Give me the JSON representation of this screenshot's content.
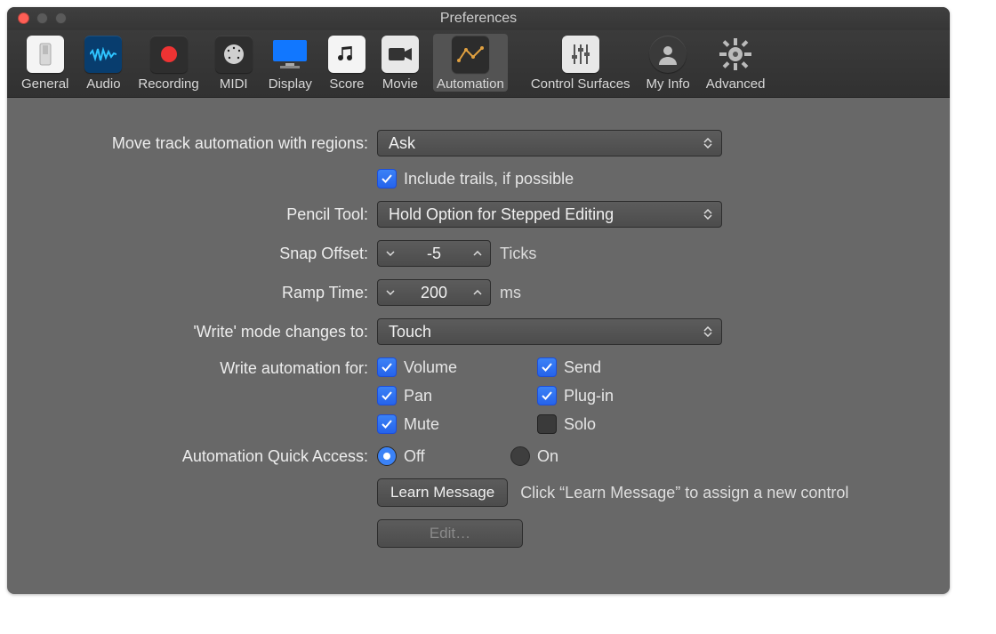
{
  "window": {
    "title": "Preferences"
  },
  "toolbar": {
    "selected": "Automation",
    "items": [
      {
        "id": "general",
        "label": "General"
      },
      {
        "id": "audio",
        "label": "Audio"
      },
      {
        "id": "recording",
        "label": "Recording"
      },
      {
        "id": "midi",
        "label": "MIDI"
      },
      {
        "id": "display",
        "label": "Display"
      },
      {
        "id": "score",
        "label": "Score"
      },
      {
        "id": "movie",
        "label": "Movie"
      },
      {
        "id": "automation",
        "label": "Automation"
      },
      {
        "id": "control-surfaces",
        "label": "Control Surfaces"
      },
      {
        "id": "my-info",
        "label": "My Info"
      },
      {
        "id": "advanced",
        "label": "Advanced"
      }
    ]
  },
  "form": {
    "move_label": "Move track automation with regions:",
    "move_value": "Ask",
    "include_trails": "Include trails, if possible",
    "pencil_label": "Pencil Tool:",
    "pencil_value": "Hold Option for Stepped Editing",
    "snap_label": "Snap Offset:",
    "snap_value": "-5",
    "snap_suffix": "Ticks",
    "ramp_label": "Ramp Time:",
    "ramp_value": "200",
    "ramp_suffix": "ms",
    "write_mode_label": "'Write' mode changes to:",
    "write_mode_value": "Touch",
    "wauto_label": "Write automation for:",
    "wauto": {
      "volume": "Volume",
      "send": "Send",
      "pan": "Pan",
      "plugin": "Plug-in",
      "mute": "Mute",
      "solo": "Solo"
    },
    "wauto_checked": {
      "volume": true,
      "send": true,
      "pan": true,
      "plugin": true,
      "mute": true,
      "solo": false
    },
    "quick_label": "Automation Quick Access:",
    "quick_value": "Off",
    "quick_off": "Off",
    "quick_on": "On",
    "learn_btn": "Learn Message",
    "learn_hint": "Click “Learn Message” to assign a new control",
    "edit_btn": "Edit…"
  }
}
